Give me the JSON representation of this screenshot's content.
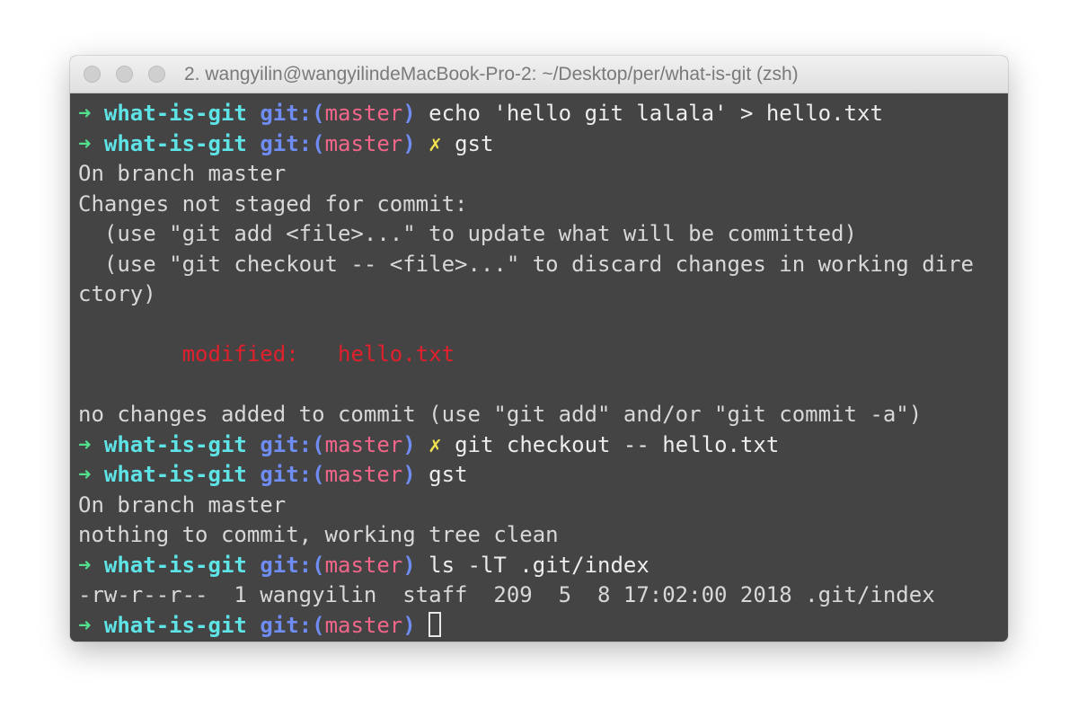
{
  "window": {
    "title": "2. wangyilin@wangyilindeMacBook-Pro-2: ~/Desktop/per/what-is-git (zsh)"
  },
  "prompt": {
    "arrow": "➜",
    "dir": "what-is-git",
    "git_open": "git:(",
    "branch": "master",
    "git_close": ")",
    "dirty_mark": "✗"
  },
  "lines": {
    "l1": {
      "cmd": "echo 'hello git lalala' > hello.txt"
    },
    "l2": {
      "cmd": "gst"
    },
    "l3": {
      "text": "On branch master"
    },
    "l4": {
      "text": "Changes not staged for commit:"
    },
    "l5": {
      "text": "  (use \"git add <file>...\" to update what will be committed)"
    },
    "l6": {
      "text": "  (use \"git checkout -- <file>...\" to discard changes in working dire"
    },
    "l7": {
      "text": "ctory)"
    },
    "l9": {
      "label": "modified:",
      "file": "hello.txt"
    },
    "l11": {
      "text": "no changes added to commit (use \"git add\" and/or \"git commit -a\")"
    },
    "l12": {
      "cmd": "git checkout -- hello.txt"
    },
    "l13": {
      "cmd": "gst"
    },
    "l14": {
      "text": "On branch master"
    },
    "l15": {
      "text": "nothing to commit, working tree clean"
    },
    "l16": {
      "cmd": "ls -lT .git/index"
    },
    "l17": {
      "text": "-rw-r--r--  1 wangyilin  staff  209  5  8 17:02:00 2018 .git/index"
    }
  },
  "colors": {
    "background": "#444444",
    "arrow": "#52e08f",
    "dir": "#5ee3e6",
    "git": "#6f8cf2",
    "branch": "#f2668a",
    "dirty": "#f0e04f",
    "modified": "#e0202c"
  }
}
